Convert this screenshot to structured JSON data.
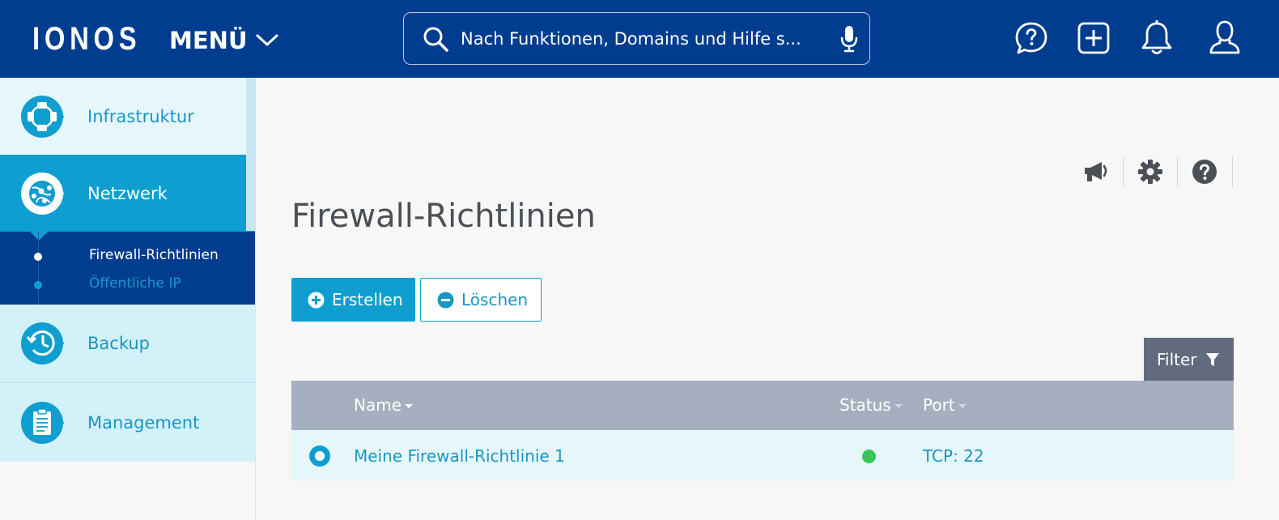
{
  "header": {
    "logo": "IONOS",
    "menu_label": "MENÜ",
    "search_placeholder": "Nach Funktionen, Domains und Hilfe s...",
    "icons": [
      "search-icon",
      "microphone-icon",
      "help-chat-icon",
      "add-icon",
      "notification-bell-icon",
      "user-icon"
    ]
  },
  "sidebar": {
    "items": [
      {
        "label": "Infrastruktur",
        "icon": "infrastructure-icon"
      },
      {
        "label": "Netzwerk",
        "icon": "network-globe-icon",
        "active": true
      },
      {
        "label": "Backup",
        "icon": "backup-clock-icon"
      },
      {
        "label": "Management",
        "icon": "clipboard-icon"
      }
    ],
    "subitems": [
      {
        "label": "Firewall-Richtlinien",
        "active": true
      },
      {
        "label": "Öffentliche IP"
      }
    ]
  },
  "main": {
    "tools": [
      "megaphone-icon",
      "settings-icon",
      "help-icon"
    ],
    "title": "Firewall-Richtlinien",
    "create_label": "Erstellen",
    "delete_label": "Löschen",
    "filter_label": "Filter",
    "columns": {
      "name": "Name",
      "status": "Status",
      "port": "Port"
    },
    "rows": [
      {
        "name": "Meine Firewall-Richtlinie 1",
        "status": "active",
        "port": "TCP: 22"
      }
    ]
  },
  "colors": {
    "header_bg": "#003d8f",
    "accent": "#0f9ed0",
    "table_header": "#a6afbf",
    "filter_bg": "#626b7e",
    "status_ok": "#3ac55a"
  }
}
